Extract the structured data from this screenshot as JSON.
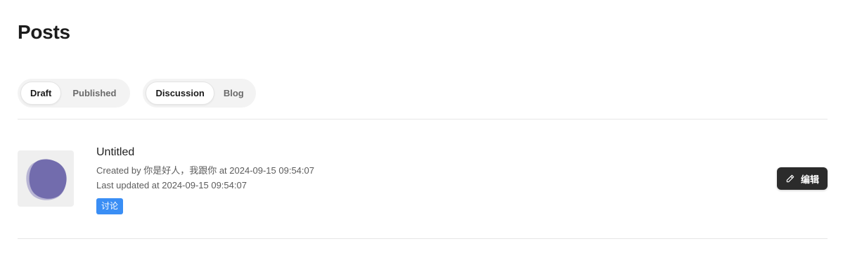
{
  "page": {
    "title": "Posts"
  },
  "filters": {
    "status": {
      "options": [
        "Draft",
        "Published"
      ],
      "selected": "Draft"
    },
    "type": {
      "options": [
        "Discussion",
        "Blog"
      ],
      "selected": "Discussion"
    }
  },
  "posts": [
    {
      "title": "Untitled",
      "created_line": "Created by 你是好人，我跟你 at 2024-09-15 09:54:07",
      "updated_line": "Last updated at 2024-09-15 09:54:07",
      "tag": "讨论",
      "thumbnail_icon": "blob-avatar",
      "edit_label": "编辑"
    }
  ],
  "colors": {
    "tag_bg": "#3a8ef5",
    "edit_button_bg": "#2b2b2b",
    "thumbnail_blob": "#6a64a8"
  }
}
